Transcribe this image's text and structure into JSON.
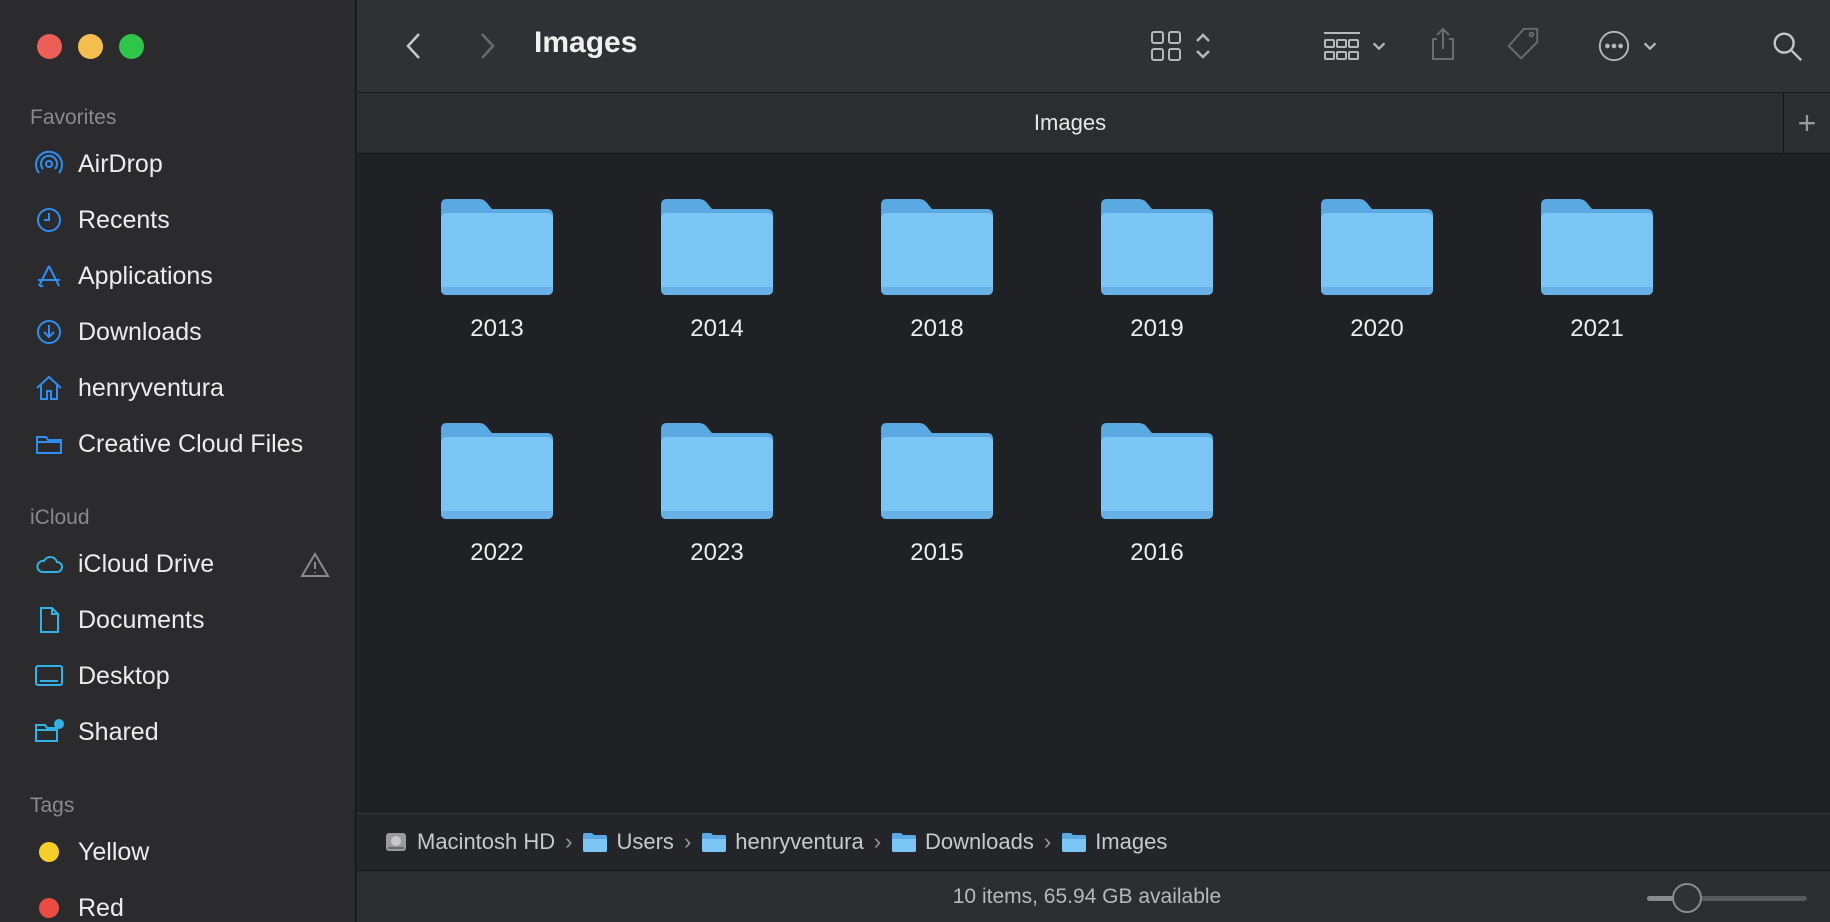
{
  "window": {
    "title": "Images"
  },
  "sidebar": {
    "favorites_title": "Favorites",
    "favorites": [
      {
        "label": "AirDrop",
        "icon": "airdrop-icon"
      },
      {
        "label": "Recents",
        "icon": "clock-icon"
      },
      {
        "label": "Applications",
        "icon": "applications-icon"
      },
      {
        "label": "Downloads",
        "icon": "download-icon"
      },
      {
        "label": "henryventura",
        "icon": "home-icon"
      },
      {
        "label": "Creative Cloud Files",
        "icon": "folder-icon"
      }
    ],
    "icloud_title": "iCloud",
    "icloud": [
      {
        "label": "iCloud Drive",
        "icon": "cloud-icon"
      },
      {
        "label": "Documents",
        "icon": "document-icon"
      },
      {
        "label": "Desktop",
        "icon": "desktop-icon"
      },
      {
        "label": "Shared",
        "icon": "shared-folder-icon"
      }
    ],
    "tags_title": "Tags",
    "tags": [
      {
        "label": "Yellow",
        "color": "#f5d02a"
      },
      {
        "label": "Red",
        "color": "#ec4b44"
      }
    ]
  },
  "tabbar": {
    "tab_label": "Images",
    "add": "+"
  },
  "folders": [
    "2013",
    "2014",
    "2018",
    "2019",
    "2020",
    "2021",
    "2022",
    "2023",
    "2015",
    "2016"
  ],
  "pathbar": [
    "Macintosh HD",
    "Users",
    "henryventura",
    "Downloads",
    "Images"
  ],
  "status": {
    "text": "10 items, 65.94 GB available",
    "icon_size_level": 0.25
  },
  "colors": {
    "accent": "#2f8ef4",
    "folder": "#7cc6f6",
    "folder_dark": "#5aa9e3"
  }
}
